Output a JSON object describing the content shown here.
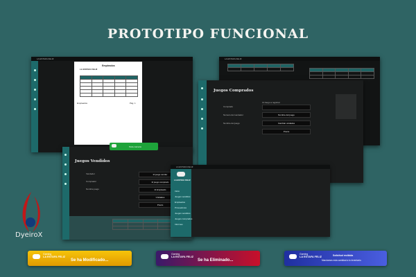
{
  "header": {
    "title": "PROTOTIPO FUNCIONAL"
  },
  "brand": {
    "logo_text": "DyeiroX",
    "small_label": "Gaming",
    "store_name": "LA ESTAFA FELIZ"
  },
  "screen1": {
    "doc_header": "Empleados",
    "doc_store": "LA ESTAFA FELIZ",
    "doc_footer": "Empleados",
    "doc_page": "Pág. 1"
  },
  "screen2": {
    "panel_title": "Vendidos"
  },
  "screen3": {
    "title": "Juegos Comprados",
    "field_label": "Id Juego a registrar",
    "rows": [
      "Comprado",
      "Numero del vendedor",
      "Nombre del juego"
    ],
    "buttons": [
      "Nombre del juego",
      "Cambiar unidades",
      "Precio"
    ]
  },
  "screen4": {
    "title": "Juegos Vendidos",
    "toast_label": "Todo correcto",
    "rows": [
      "Vendedor",
      "Comprador",
      "Nombre juego"
    ],
    "buttons": [
      "Id juego vender",
      "Id juego comprado",
      "Id Empleado",
      "Unidades",
      "Precio"
    ]
  },
  "screen5": {
    "brand_top": "LA ESTAFA FELIZ",
    "menu": [
      "Inicio",
      "Juegos vendidos",
      "Empleados",
      "Proveedores",
      "Juegos vendidos",
      "Juegos comprados",
      "Informes"
    ]
  },
  "notices": {
    "modified": "Se ha Modificado...",
    "deleted": "Se ha Eliminado...",
    "request_title": "Solicitud recibida",
    "request_body": "Mandamos esta cantidad a tu inventario."
  },
  "colors": {
    "background": "#2f6464",
    "teal": "#1d6a6a",
    "notice_modified": "#f0b000",
    "notice_deleted": "#b0102a",
    "notice_request": "#2b3fb8"
  }
}
